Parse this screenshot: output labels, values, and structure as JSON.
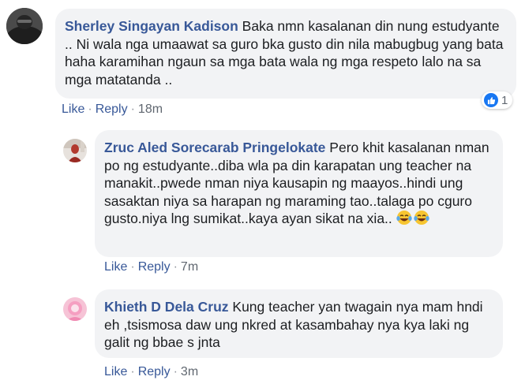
{
  "comments": [
    {
      "author": "Sherley Singayan Kadison",
      "text": "Baka nmn kasalanan din nung estudyante .. Ni wala nga umaawat sa guro bka gusto din nila mabugbug yang bata haha karamihan ngaun sa mga bata wala ng mga respeto lalo na sa mga matatanda ..",
      "like_label": "Like",
      "reply_label": "Reply",
      "time": "18m",
      "reaction_count": "1",
      "reaction_icon": "like-icon"
    },
    {
      "author": "Zruc Aled Sorecarab Pringelokate",
      "text": "Pero khit kasalanan nman po ng estudyante..diba wla pa din karapatan ung teacher na manakit..pwede nman niya kausapin ng maayos..hindi ung sasaktan niya sa harapan ng maraming tao..talaga po cguro gusto.niya lng sumikat..kaya ayan sikat na xia..",
      "emoji": "laughing-tears-emoji",
      "like_label": "Like",
      "reply_label": "Reply",
      "time": "7m"
    },
    {
      "author": "Khieth D Dela Cruz",
      "text": "Kung teacher yan twagain nya mam hndi eh ,tsismosa daw ung nkred at kasambahay nya kya laki ng galit ng bbae s jnta",
      "like_label": "Like",
      "reply_label": "Reply",
      "time": "3m"
    }
  ],
  "colors": {
    "author": "#385898",
    "bubble": "#f2f3f5",
    "meta": "#606770",
    "like_blue": "#1877f2"
  }
}
